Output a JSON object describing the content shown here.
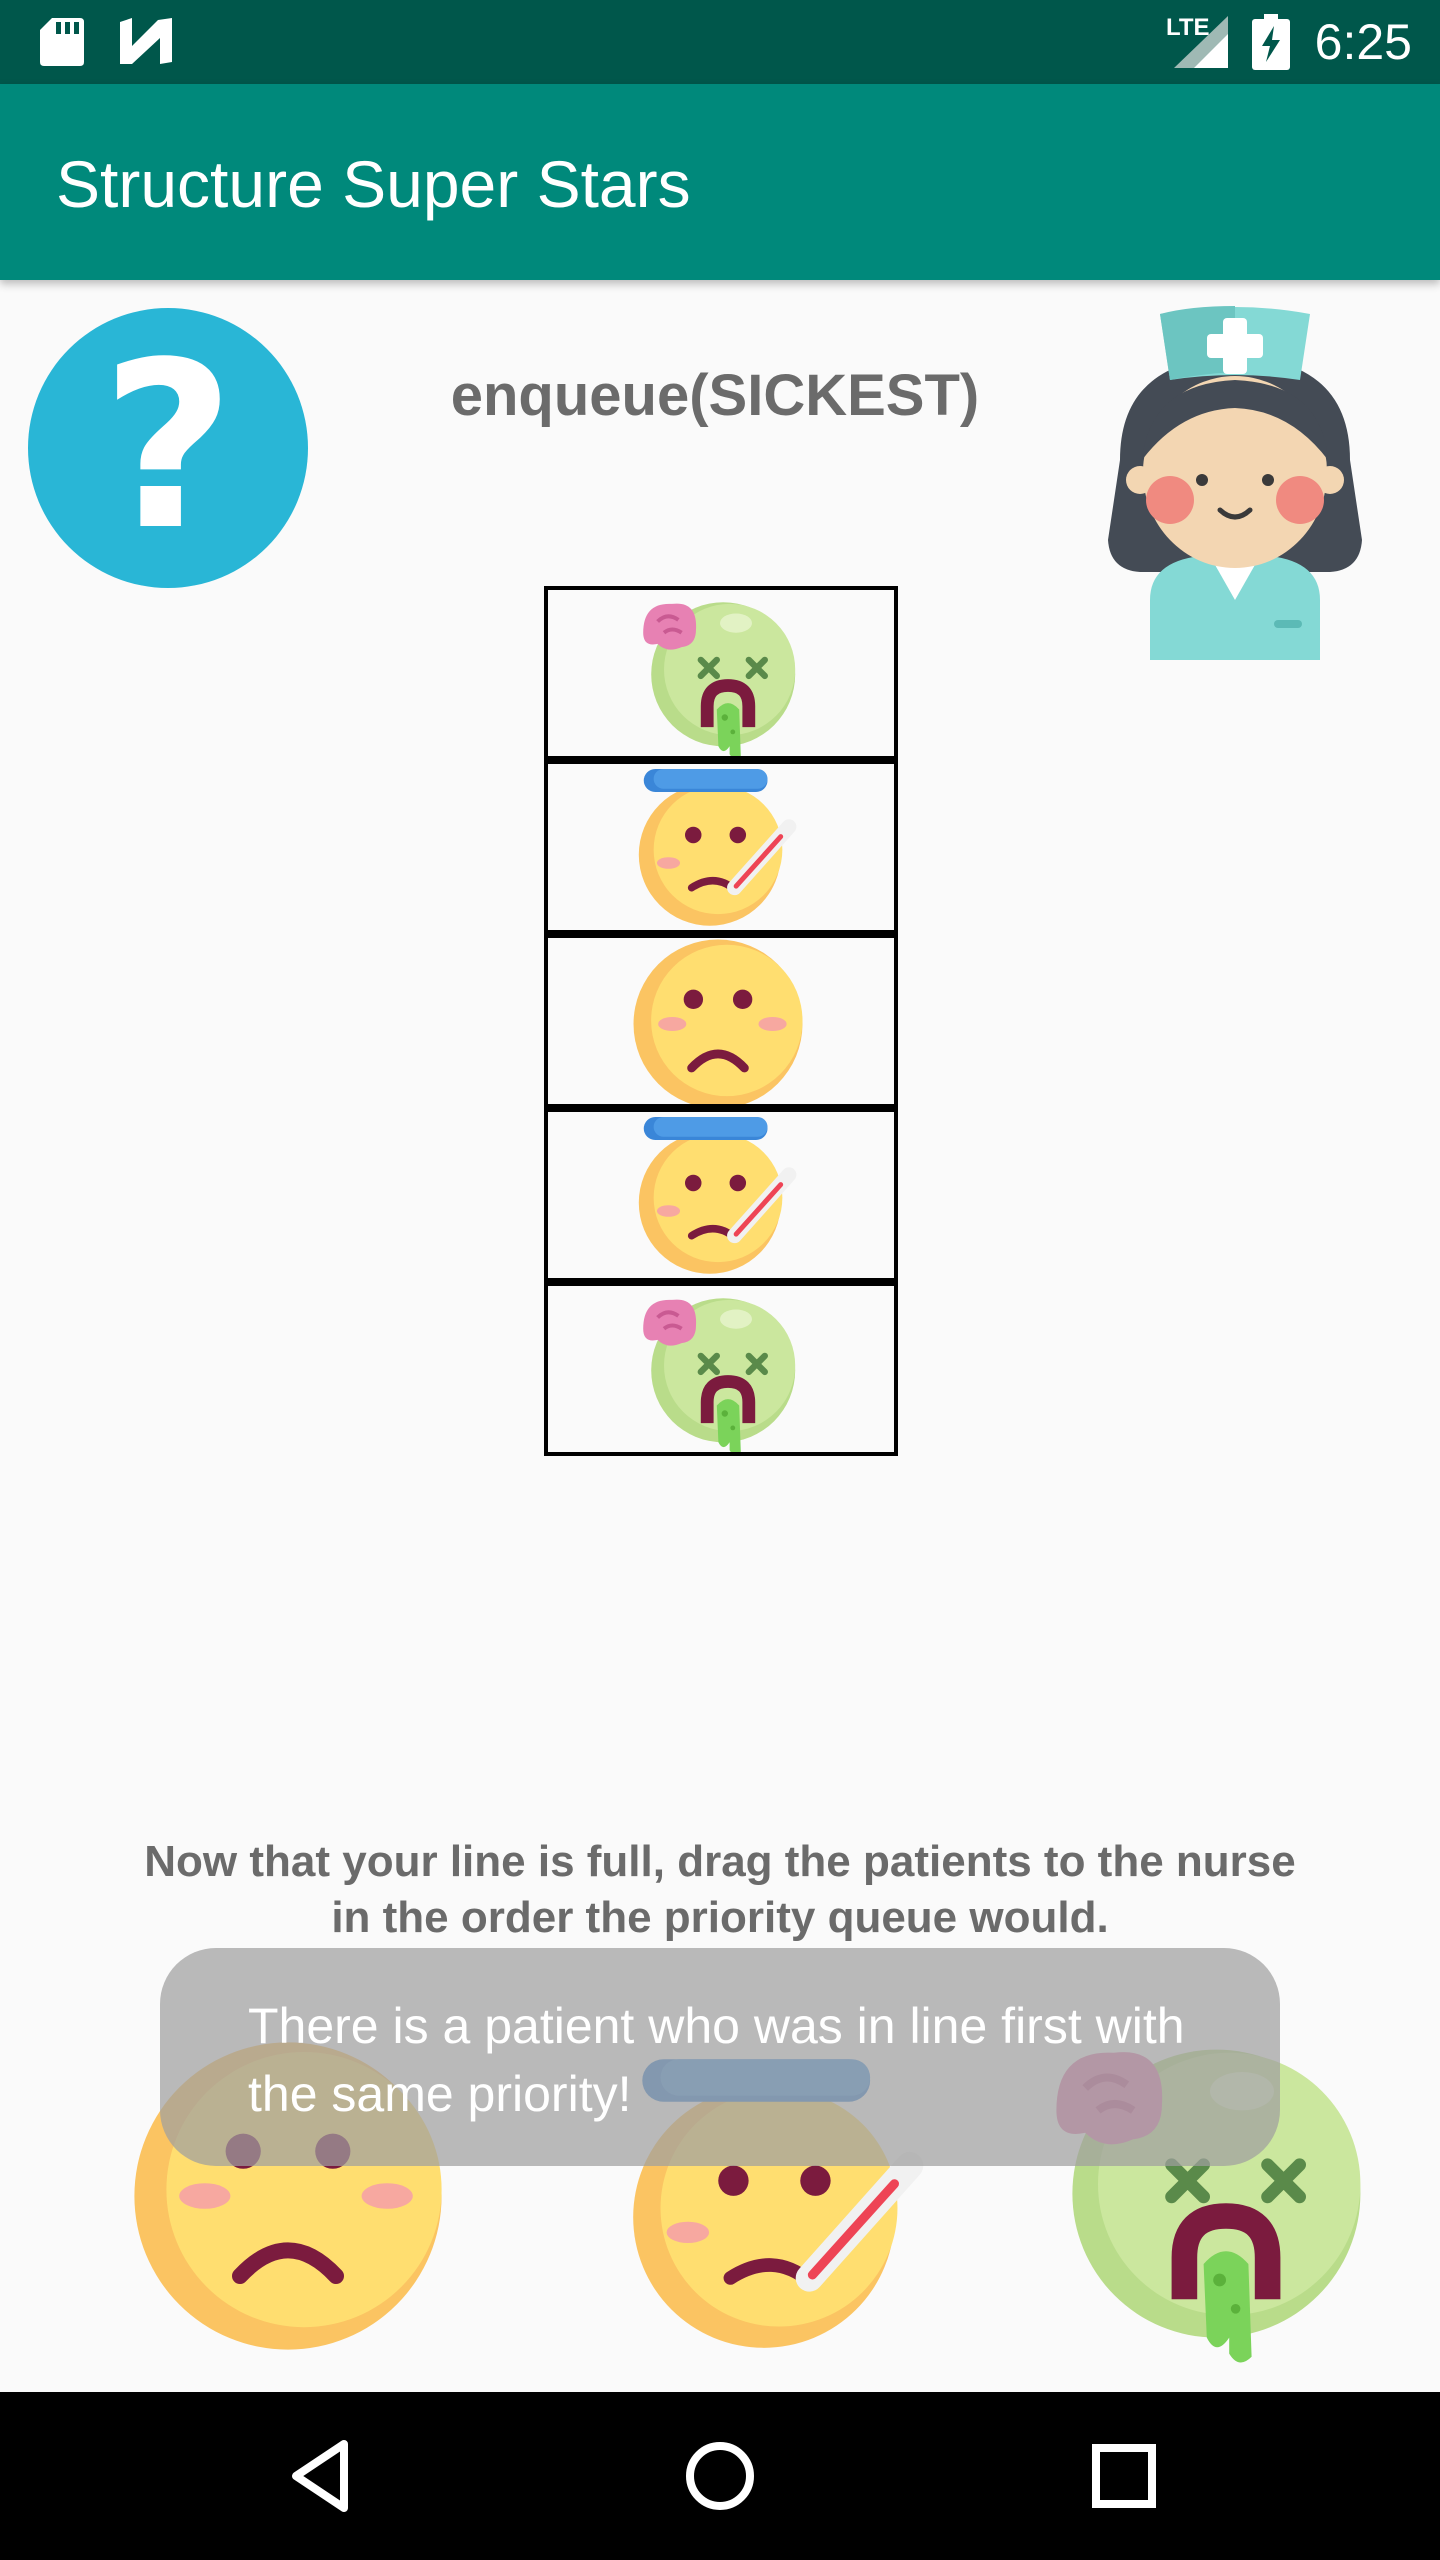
{
  "status_bar": {
    "time": "6:25",
    "icons": [
      "sd-card-icon",
      "n-icon",
      "lte-icon",
      "signal-icon",
      "battery-charging-icon"
    ]
  },
  "app_bar": {
    "title": "Structure Super Stars"
  },
  "help_button": {
    "icon": "question-mark-icon",
    "glyph": "?"
  },
  "operation": {
    "text": "enqueue(SICKEST)"
  },
  "nurse": {
    "icon": "nurse-icon"
  },
  "queue": {
    "slots": [
      {
        "patient": "sickest"
      },
      {
        "patient": "sick"
      },
      {
        "patient": "sad"
      },
      {
        "patient": "sick"
      },
      {
        "patient": "sickest"
      }
    ]
  },
  "instructions": {
    "line1": "Now that your line is full, drag the patients to the nurse",
    "line2": "in the order the priority queue would."
  },
  "patients": [
    {
      "type": "sad"
    },
    {
      "type": "sick"
    },
    {
      "type": "sickest"
    }
  ],
  "toast": {
    "line1": "There is a patient who was in line first with",
    "line2": "the same priority!"
  },
  "nav_bar": {
    "icons": [
      "back-icon",
      "home-icon",
      "recents-icon"
    ]
  },
  "colors": {
    "status_bar": "#00574b",
    "app_bar": "#00897b",
    "help": "#29b6d6",
    "face_yellow": "#ffd96a",
    "face_green": "#c5e29a"
  }
}
